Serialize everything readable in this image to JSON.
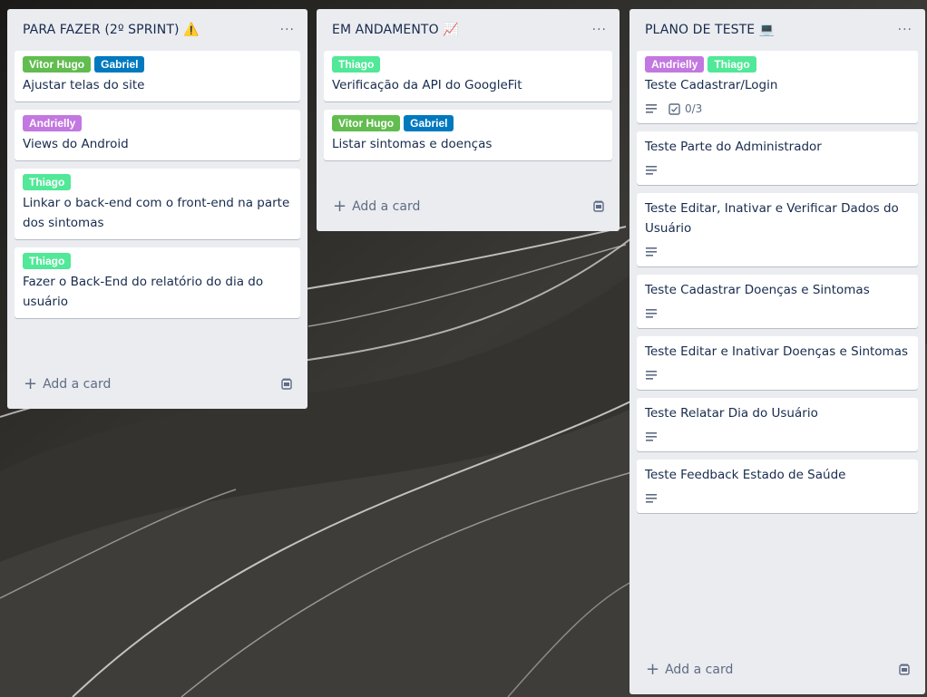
{
  "colors": {
    "green": "#61bd4f",
    "blue": "#0079bf",
    "purple": "#c377e0",
    "lime": "#51e898",
    "list_bg": "#ebecf0"
  },
  "lists": [
    {
      "title": "PARA FAZER (2º SPRINT) ⚠️",
      "menu": "···",
      "cards": [
        {
          "labels": [
            {
              "text": "Vitor Hugo",
              "color": "green"
            },
            {
              "text": "Gabriel",
              "color": "blue"
            }
          ],
          "title": "Ajustar telas do site"
        },
        {
          "labels": [
            {
              "text": "Andrielly",
              "color": "purple"
            }
          ],
          "title": "Views do Android"
        },
        {
          "labels": [
            {
              "text": "Thiago",
              "color": "lime"
            }
          ],
          "title": "Linkar o back-end com o front-end na parte dos sintomas"
        },
        {
          "labels": [
            {
              "text": "Thiago",
              "color": "lime"
            }
          ],
          "title": "Fazer o Back-End do relatório do dia do usuário"
        }
      ],
      "add_label": "Add a card"
    },
    {
      "title": "EM ANDAMENTO 📈",
      "menu": "···",
      "cards": [
        {
          "labels": [
            {
              "text": "Thiago",
              "color": "lime"
            }
          ],
          "title": "Verificação da API do GoogleFit"
        },
        {
          "labels": [
            {
              "text": "Vitor Hugo",
              "color": "green"
            },
            {
              "text": "Gabriel",
              "color": "blue"
            }
          ],
          "title": "Listar sintomas e doenças"
        }
      ],
      "add_label": "Add a card"
    },
    {
      "title": "PLANO DE TESTE 💻",
      "menu": "···",
      "cards": [
        {
          "labels": [
            {
              "text": "Andrielly",
              "color": "purple"
            },
            {
              "text": "Thiago",
              "color": "lime"
            }
          ],
          "title": "Teste Cadastrar/Login",
          "description": true,
          "checklist": "0/3"
        },
        {
          "title": "Teste Parte do Administrador",
          "description": true
        },
        {
          "title": "Teste Editar, Inativar e Verificar Dados do Usuário",
          "description": true
        },
        {
          "title": "Teste Cadastrar Doenças e Sintomas",
          "description": true
        },
        {
          "title": "Teste Editar e Inativar Doenças e Sintomas",
          "description": true
        },
        {
          "title": "Teste Relatar Dia do Usuário",
          "description": true
        },
        {
          "title": "Teste Feedback Estado de Saúde",
          "description": true
        }
      ],
      "add_label": "Add a card"
    }
  ]
}
